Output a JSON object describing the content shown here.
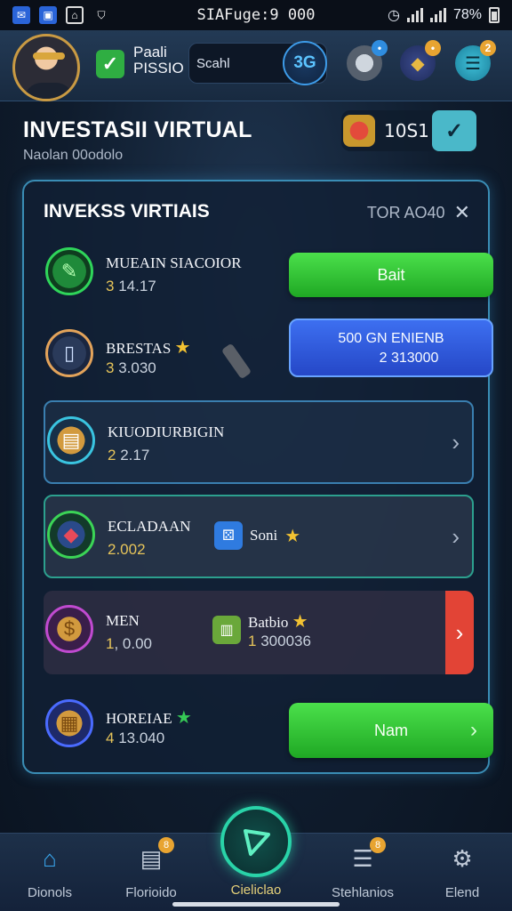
{
  "status_bar": {
    "center_text": "SIAFuge:9 000",
    "battery": "78%"
  },
  "header": {
    "user_name_line1": "Paali",
    "user_name_line2": "PISSIO",
    "search_text": "Scahl",
    "search_button_label": "3G"
  },
  "page": {
    "title": "INVESTASII VIRTUAL",
    "subtitle": "Naolan 00odolo",
    "coin_value": "10S1"
  },
  "panel": {
    "title": "INVEKSS VIRTIAIS",
    "right_label": "TOR AO40",
    "rows": [
      {
        "name": "MUEAIN SIACOIOR",
        "value_prefix": "3",
        "value_rest": "14.17",
        "button_label": "Bait"
      },
      {
        "name": "BRESTAS",
        "value_prefix": "3",
        "value_rest": "3.030",
        "button_line1": "500 GN ENIENB",
        "button_line2": "2 313000"
      },
      {
        "name": "KIUODIURBIGIN",
        "value_prefix": "2",
        "value_rest": "2.17"
      },
      {
        "name": "ECLADAAN",
        "value_prefix": "2.002",
        "value_rest": "",
        "mid_label": "Soni"
      },
      {
        "name": "MEN",
        "value_prefix": "1",
        "value_rest": ", 0.00",
        "mid_label": "Batbio",
        "mid_value_prefix": "1",
        "mid_value_rest": "300036"
      },
      {
        "name": "HOREIAE",
        "value_prefix": "4",
        "value_rest": "13.040",
        "button_label": "Nam"
      }
    ]
  },
  "bottom_nav": {
    "items": [
      {
        "label": "Dionols",
        "icon": "home-icon"
      },
      {
        "label": "Florioido",
        "icon": "document-icon",
        "badge": "8"
      },
      {
        "label": "Cieliclao",
        "icon": "play-icon"
      },
      {
        "label": "Stehlanios",
        "icon": "list-icon",
        "badge": "8"
      },
      {
        "label": "Elend",
        "icon": "gear-icon"
      }
    ]
  },
  "colors": {
    "accent_green": "#2fc536",
    "accent_blue": "#2f5be0",
    "accent_red": "#e24436",
    "panel_border": "#3a8db5"
  }
}
